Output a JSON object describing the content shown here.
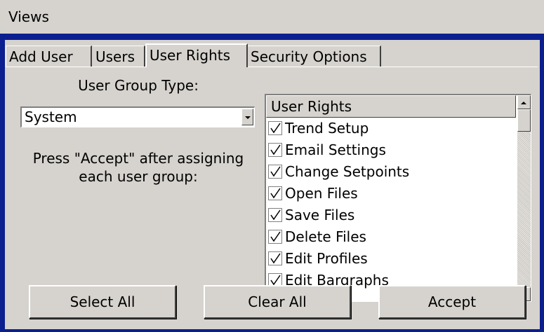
{
  "window": {
    "title": "Views"
  },
  "tabs": [
    {
      "label": "Add User"
    },
    {
      "label": "Users"
    },
    {
      "label": "User Rights",
      "active": true
    },
    {
      "label": "Security Options"
    }
  ],
  "user_group": {
    "label": "User Group Type:",
    "selected": "System",
    "instructions": "Press \"Accept\" after assigning each user group:"
  },
  "rights_list": {
    "header": "User Rights",
    "items": [
      {
        "label": "Trend Setup",
        "checked": true
      },
      {
        "label": "Email Settings",
        "checked": true
      },
      {
        "label": "Change Setpoints",
        "checked": true
      },
      {
        "label": "Open Files",
        "checked": true
      },
      {
        "label": "Save Files",
        "checked": true
      },
      {
        "label": "Delete Files",
        "checked": true
      },
      {
        "label": "Edit Profiles",
        "checked": true
      },
      {
        "label": "Edit Bargraphs",
        "checked": true
      }
    ]
  },
  "buttons": {
    "select_all": "Select All",
    "clear_all": "Clear All",
    "accept": "Accept"
  },
  "colors": {
    "frame": "#0c1f8f",
    "face": "#d6d3ce"
  }
}
